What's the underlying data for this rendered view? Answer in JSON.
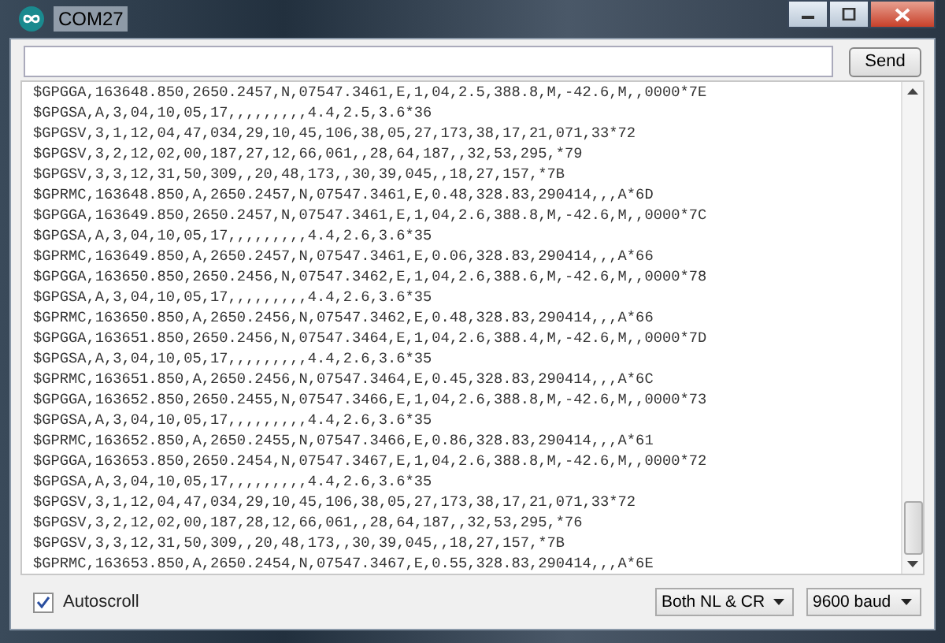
{
  "window": {
    "title": "COM27"
  },
  "send_button": "Send",
  "lines": [
    "$GPGGA,163648.850,2650.2457,N,07547.3461,E,1,04,2.5,388.8,M,-42.6,M,,0000*7E",
    "$GPGSA,A,3,04,10,05,17,,,,,,,,,4.4,2.5,3.6*36",
    "$GPGSV,3,1,12,04,47,034,29,10,45,106,38,05,27,173,38,17,21,071,33*72",
    "$GPGSV,3,2,12,02,00,187,27,12,66,061,,28,64,187,,32,53,295,*79",
    "$GPGSV,3,3,12,31,50,309,,20,48,173,,30,39,045,,18,27,157,*7B",
    "$GPRMC,163648.850,A,2650.2457,N,07547.3461,E,0.48,328.83,290414,,,A*6D",
    "$GPGGA,163649.850,2650.2457,N,07547.3461,E,1,04,2.6,388.8,M,-42.6,M,,0000*7C",
    "$GPGSA,A,3,04,10,05,17,,,,,,,,,4.4,2.6,3.6*35",
    "$GPRMC,163649.850,A,2650.2457,N,07547.3461,E,0.06,328.83,290414,,,A*66",
    "$GPGGA,163650.850,2650.2456,N,07547.3462,E,1,04,2.6,388.6,M,-42.6,M,,0000*78",
    "$GPGSA,A,3,04,10,05,17,,,,,,,,,4.4,2.6,3.6*35",
    "$GPRMC,163650.850,A,2650.2456,N,07547.3462,E,0.48,328.83,290414,,,A*66",
    "$GPGGA,163651.850,2650.2456,N,07547.3464,E,1,04,2.6,388.4,M,-42.6,M,,0000*7D",
    "$GPGSA,A,3,04,10,05,17,,,,,,,,,4.4,2.6,3.6*35",
    "$GPRMC,163651.850,A,2650.2456,N,07547.3464,E,0.45,328.83,290414,,,A*6C",
    "$GPGGA,163652.850,2650.2455,N,07547.3466,E,1,04,2.6,388.8,M,-42.6,M,,0000*73",
    "$GPGSA,A,3,04,10,05,17,,,,,,,,,4.4,2.6,3.6*35",
    "$GPRMC,163652.850,A,2650.2455,N,07547.3466,E,0.86,328.83,290414,,,A*61",
    "$GPGGA,163653.850,2650.2454,N,07547.3467,E,1,04,2.6,388.8,M,-42.6,M,,0000*72",
    "$GPGSA,A,3,04,10,05,17,,,,,,,,,4.4,2.6,3.6*35",
    "$GPGSV,3,1,12,04,47,034,29,10,45,106,38,05,27,173,38,17,21,071,33*72",
    "$GPGSV,3,2,12,02,00,187,28,12,66,061,,28,64,187,,32,53,295,*76",
    "$GPGSV,3,3,12,31,50,309,,20,48,173,,30,39,045,,18,27,157,*7B",
    "$GPRMC,163653.850,A,2650.2454,N,07547.3467,E,0.55,328.83,290414,,,A*6E"
  ],
  "autoscroll": {
    "label": "Autoscroll",
    "checked": true
  },
  "line_ending": "Both NL & CR",
  "baud_rate": "9600 baud"
}
